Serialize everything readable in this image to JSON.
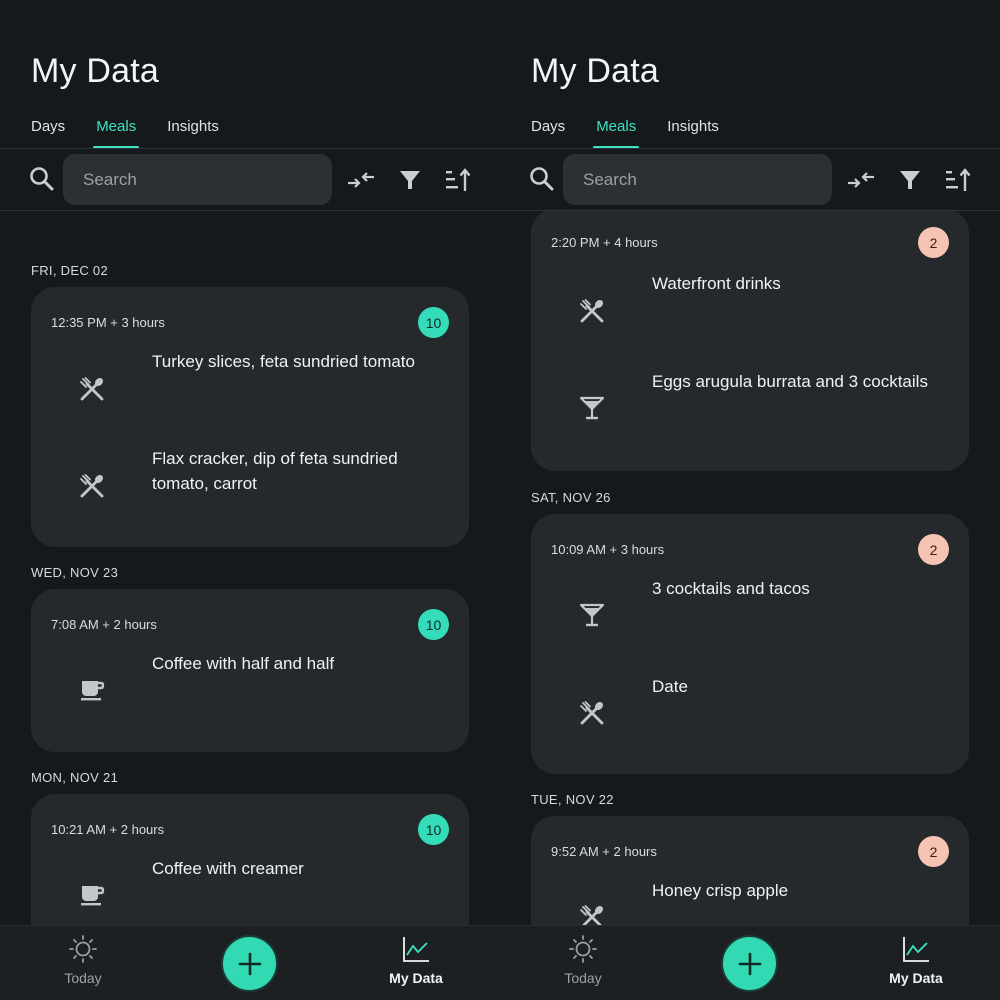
{
  "screens": [
    {
      "page_title": "My Data",
      "tabs": [
        {
          "label": "Days"
        },
        {
          "label": "Meals"
        },
        {
          "label": "Insights"
        }
      ],
      "active_tab": "Meals",
      "search": {
        "placeholder": "Search",
        "value": ""
      },
      "date_groups": [
        {
          "date": "FRI, DEC 02",
          "cards": [
            {
              "time": "12:35 PM + 3 hours",
              "badge": "10",
              "badge_color": "#35dcb9",
              "entries": [
                {
                  "icon": "utensils-icon",
                  "text": "Turkey slices, feta sundried tomato"
                },
                {
                  "icon": "utensils-icon",
                  "text": "Flax cracker, dip of feta sundried tomato, carrot"
                }
              ]
            }
          ]
        },
        {
          "date": "WED, NOV 23",
          "cards": [
            {
              "time": "7:08 AM + 2 hours",
              "badge": "10",
              "badge_color": "#35dcb9",
              "entries": [
                {
                  "icon": "coffee-cup-icon",
                  "text": "Coffee with half and half"
                }
              ]
            }
          ]
        },
        {
          "date": "MON, NOV 21",
          "cards": [
            {
              "time": "10:21 AM + 2 hours",
              "badge": "10",
              "badge_color": "#35dcb9",
              "entries": [
                {
                  "icon": "coffee-cup-icon",
                  "text": "Coffee with creamer"
                }
              ]
            }
          ]
        }
      ]
    },
    {
      "page_title": "My Data",
      "tabs": [
        {
          "label": "Days"
        },
        {
          "label": "Meals"
        },
        {
          "label": "Insights"
        }
      ],
      "active_tab": "Meals",
      "search": {
        "placeholder": "Search",
        "value": ""
      },
      "date_groups": [
        {
          "date": "",
          "cards": [
            {
              "time": "2:20 PM + 4 hours",
              "badge": "2",
              "badge_color": "#f7c3b3",
              "entries": [
                {
                  "icon": "utensils-icon",
                  "text": "Waterfront drinks"
                },
                {
                  "icon": "cocktail-glass-icon",
                  "text": "Eggs arugula burrata and 3 cocktails"
                }
              ]
            }
          ]
        },
        {
          "date": "SAT, NOV 26",
          "cards": [
            {
              "time": "10:09 AM + 3 hours",
              "badge": "2",
              "badge_color": "#f7c3b3",
              "entries": [
                {
                  "icon": "cocktail-glass-icon",
                  "text": "3 cocktails and tacos"
                },
                {
                  "icon": "utensils-icon",
                  "text": "Date"
                }
              ]
            }
          ]
        },
        {
          "date": "TUE, NOV 22",
          "cards": [
            {
              "time": "9:52 AM + 2 hours",
              "badge": "2",
              "badge_color": "#f7c3b3",
              "entries": [
                {
                  "icon": "utensils-icon",
                  "text": "Honey crisp apple"
                }
              ]
            }
          ]
        }
      ]
    }
  ],
  "bottom_nav": {
    "today_label": "Today",
    "mydata_label": "My Data",
    "add_icon": "plus-icon"
  },
  "colors": {
    "accent": "#3fe0c0",
    "fab": "#33d9b3",
    "background": "#16191c",
    "card": "#25292c"
  }
}
